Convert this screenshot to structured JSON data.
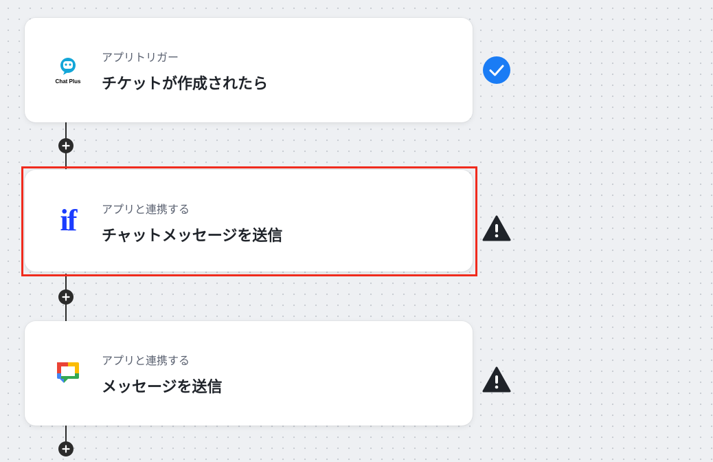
{
  "flow": {
    "steps": [
      {
        "subtitle": "アプリトリガー",
        "title": "チケットが作成されたら",
        "app_icon": "chat-plus-logo",
        "app_label": "Chat Plus",
        "status": "complete",
        "status_icon": "check-circle-icon",
        "status_color": "#1a7cf5"
      },
      {
        "subtitle": "アプリと連携する",
        "title": "チャットメッセージを送信",
        "app_icon": "if-logo",
        "app_label": "if",
        "status": "warning",
        "status_icon": "warning-icon",
        "highlighted": true,
        "highlight_color": "#f02b1d"
      },
      {
        "subtitle": "アプリと連携する",
        "title": "メッセージを送信",
        "app_icon": "google-chat-logo",
        "status": "warning",
        "status_icon": "warning-icon"
      }
    ],
    "add_step_icon": "plus-icon"
  }
}
